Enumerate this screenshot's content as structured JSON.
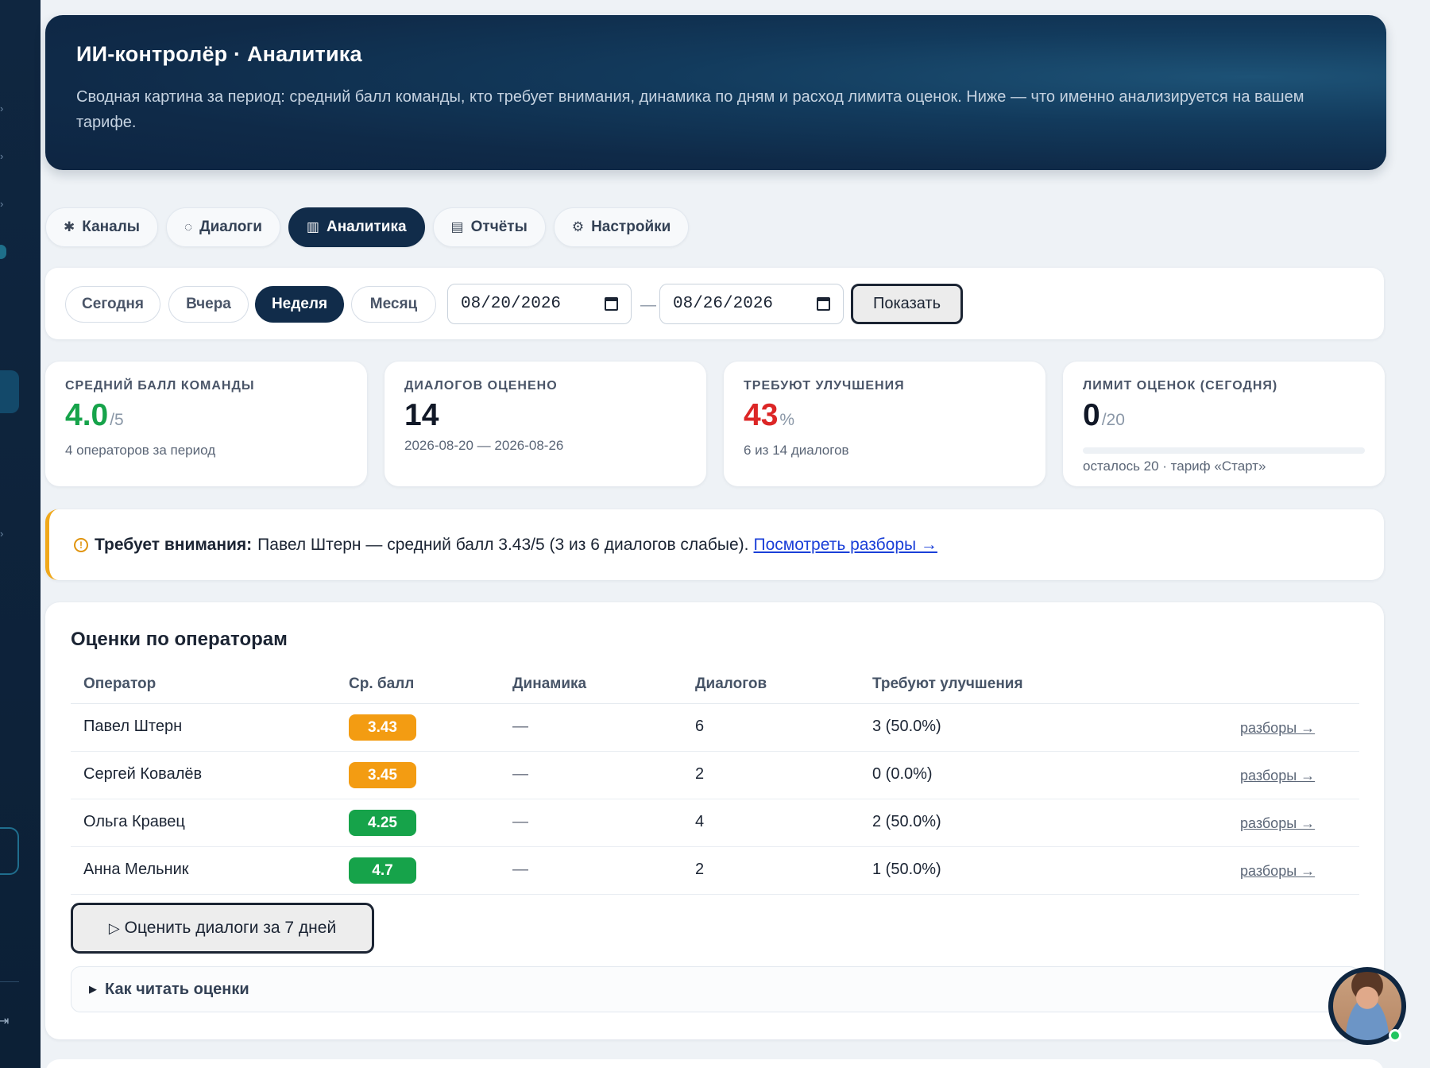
{
  "header": {
    "title": "ИИ-контролёр · Аналитика",
    "description": "Сводная картина за период: средний балл команды, кто требует внимания, динамика по дням и расход лимита оценок. Ниже — что именно анализируется на вашем тарифе."
  },
  "tabs": [
    {
      "label": "Каналы",
      "icon": "satellite-icon"
    },
    {
      "label": "Диалоги",
      "icon": "chat-icon"
    },
    {
      "label": "Аналитика",
      "icon": "bar-chart-icon",
      "active": true
    },
    {
      "label": "Отчёты",
      "icon": "document-icon"
    },
    {
      "label": "Настройки",
      "icon": "gear-icon"
    }
  ],
  "filters": {
    "periods": [
      "Сегодня",
      "Вчера",
      "Неделя",
      "Месяц"
    ],
    "active_period": "Неделя",
    "date_from": "08/20/2026",
    "date_separator": "—",
    "date_to": "08/26/2026",
    "show_label": "Показать"
  },
  "cards": {
    "avg": {
      "label": "СРЕДНИЙ БАЛЛ КОМАНДЫ",
      "value": "4.0",
      "suffix": "/5",
      "note": "4 операторов за период",
      "color": "#16a34a"
    },
    "dialogs": {
      "label": "ДИАЛОГОВ ОЦЕНЕНО",
      "value": "14",
      "note": "2026-08-20 — 2026-08-26"
    },
    "improve": {
      "label": "ТРЕБУЮТ УЛУЧШЕНИЯ",
      "value": "43",
      "suffix": "%",
      "note": "6 из 14 диалогов",
      "color": "#dc2626"
    },
    "limit": {
      "label": "ЛИМИТ ОЦЕНОК (СЕГОДНЯ)",
      "value": "0",
      "suffix": "/20",
      "note": "осталось 20 · тариф «Старт»",
      "used_fraction": 0
    }
  },
  "alert": {
    "title": "Требует внимания:",
    "text": "Павел Штерн — средний балл 3.43/5 (3 из 6 диалогов слабые).",
    "link": "Посмотреть разборы →"
  },
  "table": {
    "title": "Оценки по операторам",
    "headers": [
      "Оператор",
      "Ср. балл",
      "Динамика",
      "Диалогов",
      "Требуют улучшения"
    ],
    "rows": [
      {
        "name": "Павел Штерн",
        "score": "3.43",
        "trend": "—",
        "dialogs": "6",
        "improve": "3 (50.0%)",
        "link": "разборы →",
        "color": "#f39c12"
      },
      {
        "name": "Сергей Ковалёв",
        "score": "3.45",
        "trend": "—",
        "dialogs": "2",
        "improve": "0 (0.0%)",
        "link": "разборы →",
        "color": "#f39c12"
      },
      {
        "name": "Ольга Кравец",
        "score": "4.25",
        "trend": "—",
        "dialogs": "4",
        "improve": "2 (50.0%)",
        "link": "разборы →",
        "color": "#16a34a"
      },
      {
        "name": "Анна Мельник",
        "score": "4.7",
        "trend": "—",
        "dialogs": "2",
        "improve": "1 (50.0%)",
        "link": "разборы →",
        "color": "#16a34a"
      }
    ],
    "run_button": "Оценить диалоги за 7 дней",
    "details_label": "Как читать оценки"
  }
}
